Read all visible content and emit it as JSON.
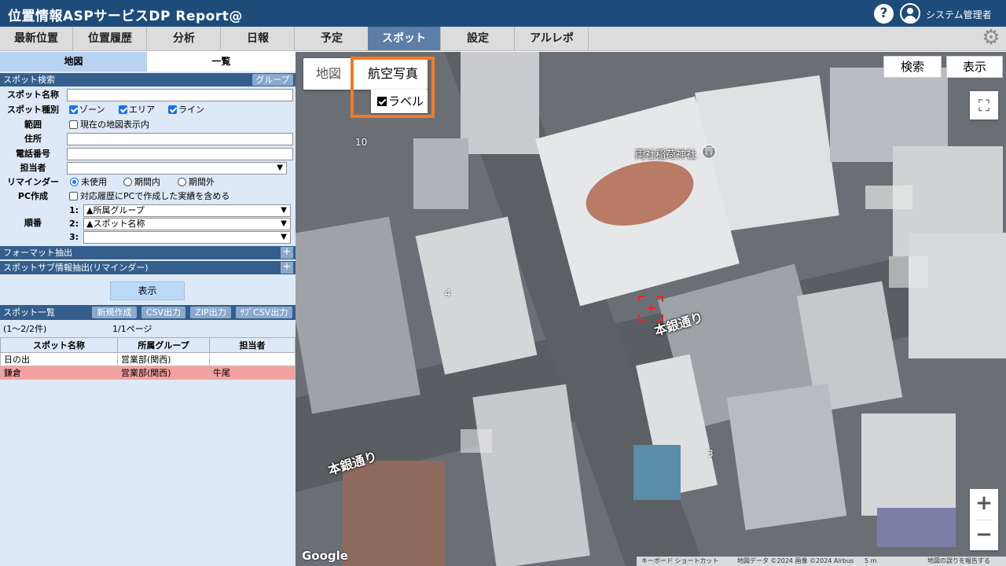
{
  "header": {
    "title": "位置情報ASPサービスDP Report@",
    "help_icon": "help-icon",
    "user_icon": "user-icon",
    "user_name": "システム管理者"
  },
  "nav": {
    "tabs": [
      {
        "label": "最新位置"
      },
      {
        "label": "位置履歴"
      },
      {
        "label": "分析"
      },
      {
        "label": "日報"
      },
      {
        "label": "予定"
      },
      {
        "label": "スポット",
        "active": true
      },
      {
        "label": "設定"
      },
      {
        "label": "アルレポ"
      }
    ],
    "gear_icon": "gear-icon"
  },
  "left": {
    "tabs": {
      "map": "地図",
      "list": "一覧"
    },
    "search": {
      "title": "スポット検索",
      "group_btn": "グループ",
      "fields": {
        "spot_name": {
          "label": "スポット名称",
          "value": ""
        },
        "spot_type": {
          "label": "スポット種別",
          "zone": "ゾーン",
          "area": "エリア",
          "line": "ライン"
        },
        "range": {
          "label": "範囲",
          "option": "現在の地図表示内"
        },
        "address": {
          "label": "住所",
          "value": ""
        },
        "phone": {
          "label": "電話番号",
          "value": ""
        },
        "owner": {
          "label": "担当者",
          "value": ""
        },
        "reminder": {
          "label": "リマインダー",
          "unused": "未使用",
          "in_period": "期間内",
          "out_period": "期間外"
        },
        "pc": {
          "label": "PC作成",
          "option": "対応履歴にPCで作成した実績を含める"
        },
        "order": {
          "label": "順番",
          "items": [
            {
              "num": "1:",
              "value": "▲所属グループ"
            },
            {
              "num": "2:",
              "value": "▲スポット名称"
            },
            {
              "num": "3:",
              "value": ""
            }
          ]
        }
      }
    },
    "format_title": "フォーマット抽出",
    "sub_title": "スポットサブ情報抽出(リマインダー)",
    "show_btn": "表示",
    "list": {
      "title": "スポット一覧",
      "buttons": {
        "new": "新規作成",
        "csv": "CSV出力",
        "zip": "ZIP出力",
        "subcsv": "ｻﾌﾞCSV出力"
      },
      "count": "(1〜2/2件)",
      "page": "1/1ページ",
      "columns": [
        "スポット名称",
        "所属グループ",
        "担当者"
      ],
      "rows": [
        {
          "name": "日の出",
          "group": "営業部(関西)",
          "owner": ""
        },
        {
          "name": "鎌倉",
          "group": "営業部(関西)",
          "owner": "牛尾",
          "selected": true
        }
      ]
    }
  },
  "map": {
    "type_map": "地図",
    "type_satellite": "航空写真",
    "label_option": "ラベル",
    "search_btn": "検索",
    "show_btn": "表示",
    "street_1": "本銀通り",
    "street_2": "本銀通り",
    "poi": "両社稲荷神社",
    "poi_icon": "shrine-icon",
    "numbers": [
      "10",
      "4",
      "3"
    ],
    "google": "Google",
    "attribution": {
      "keyboard": "キーボード ショートカット",
      "data": "地図データ ©2024 画像 ©2024 Airbus",
      "scale": "5 m",
      "report": "地図の誤りを報告する"
    },
    "fullscreen_icon": "fullscreen-icon",
    "zoom_in": "+",
    "zoom_out": "−",
    "target_icon": "target-icon"
  }
}
